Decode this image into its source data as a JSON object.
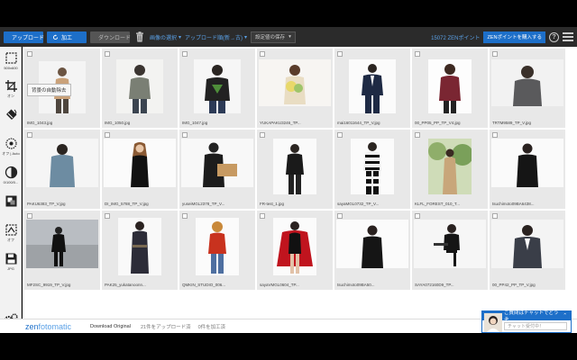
{
  "toolbar": {
    "upload_label": "アップロード",
    "process_label": "加工",
    "download_label": "ダウンロード",
    "select_images_label": "画像の選択",
    "upload_order_label": "アップロード順(新→古)",
    "save_settings_label": "設定値の保存",
    "points_label": "15072 ZENポイント",
    "buy_points_label": "ZENポイントを購入する",
    "help_label": "?"
  },
  "sidebar": {
    "tools": [
      {
        "icon": "crop-size-icon",
        "label": "500x600"
      },
      {
        "icon": "crop-icon",
        "label": "オン"
      },
      {
        "icon": "background-removal-icon",
        "label": ""
      },
      {
        "icon": "exposure-icon",
        "label": "オフ | Auto"
      },
      {
        "icon": "contrast-icon",
        "label": "0/100/0..."
      },
      {
        "icon": "shadow-icon",
        "label": ""
      },
      {
        "icon": "margin-icon",
        "label": "オフ"
      },
      {
        "icon": "save-format-icon",
        "label": "JPG"
      },
      {
        "icon": "settings-icon",
        "label": ""
      }
    ],
    "tooltip": "背景の自動除去"
  },
  "images": [
    {
      "caption": "IMG_1043.jpg",
      "bg": "#f4f4f4"
    },
    {
      "caption": "IMG_1050.jpg",
      "bg": "#f3f3f1"
    },
    {
      "caption": "IMG_1047.jpg",
      "bg": "#f6f6f6"
    },
    {
      "caption": "YUKAPAKU3246_TP...",
      "bg": "#f7f5f2"
    },
    {
      "caption": "mai16011644_TP_V.jpg",
      "bg": "#fbfbfb"
    },
    {
      "caption": "00_PP05_PP_TP_V4.jpg",
      "bg": "#fdfdfd"
    },
    {
      "caption": "TRTM9589_TP_V.jpg",
      "bg": "#f2f2f2"
    },
    {
      "caption": "PAKU6383_TP_V.jpg",
      "bg": "#f5f5f5"
    },
    {
      "caption": "DI_IMG_5788_TP_V.jpg",
      "bg": "#fbfbfb"
    },
    {
      "caption": "yuseiMGL2378_TP_V...",
      "bg": "#f8f8f8"
    },
    {
      "caption": "FR-test_1.jpg",
      "bg": "#fafafa"
    },
    {
      "caption": "sayaMGL0732_TP_V...",
      "bg": "#fbfbfb"
    },
    {
      "caption": "KLFL_FOREST_010_T...",
      "bg": "#e7ede0"
    },
    {
      "caption": "tsuchimoto09BA6438...",
      "bg": "#fafafa"
    },
    {
      "caption": "MF2SC_9919_TP_V.jpg",
      "bg": "#d5d7d9"
    },
    {
      "caption": "PAK25_yukatanoonn...",
      "bg": "#f9f9f9"
    },
    {
      "caption": "QMKIN_STUDIO_006...",
      "bg": "#fbfbfb"
    },
    {
      "caption": "sayaVMGL0604_TP...",
      "bg": "#fbfbfb"
    },
    {
      "caption": "tsuchimoto09BA50...",
      "bg": "#fbfbfb"
    },
    {
      "caption": "SAYA072160D9_TP...",
      "bg": "#f6f6f6"
    },
    {
      "caption": "00_PP42_PP_TP_V.jpg",
      "bg": "#f4f4f4"
    }
  ],
  "footer": {
    "logo_a": "zen",
    "logo_b": "fotomatic",
    "download_original": "Download Original",
    "uploaded_status": "21件をアップロード済",
    "processed_status": "0件を加工済"
  },
  "chat": {
    "header": "ご質問はチャットでどうぞ",
    "placeholder": "チャット受付中！"
  },
  "colors": {
    "accent": "#1d6fc9",
    "toolbar_bg": "#2b2b2b",
    "link": "#5aa0e6"
  }
}
